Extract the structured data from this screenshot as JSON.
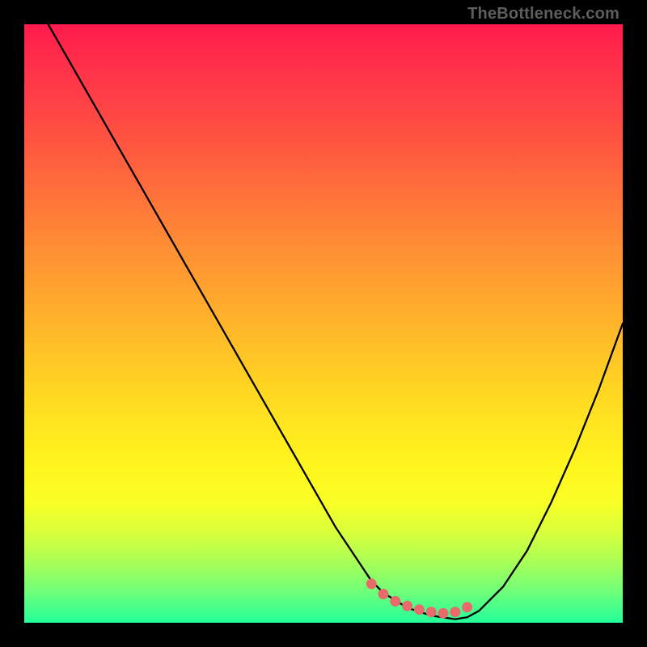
{
  "attribution": "TheBottleneck.com",
  "chart_data": {
    "type": "line",
    "title": "",
    "xlabel": "",
    "ylabel": "",
    "xlim": [
      0,
      100
    ],
    "ylim": [
      0,
      100
    ],
    "x": [
      4,
      8,
      12,
      16,
      20,
      24,
      28,
      32,
      36,
      40,
      44,
      48,
      52,
      56,
      58,
      60,
      64,
      68,
      72,
      74,
      76,
      80,
      84,
      88,
      92,
      96,
      100
    ],
    "values": [
      100,
      93,
      86,
      79,
      72,
      65,
      58,
      51,
      44,
      37,
      30,
      23,
      16,
      10,
      7,
      5,
      2.5,
      1.2,
      0.6,
      0.9,
      2,
      6,
      12,
      20,
      29,
      39,
      50
    ],
    "markers": {
      "x": [
        58,
        60,
        62,
        64,
        66,
        68,
        70,
        72,
        74
      ],
      "values": [
        6.5,
        4.8,
        3.6,
        2.8,
        2.2,
        1.8,
        1.6,
        1.8,
        2.6
      ],
      "color": "#e96a6a"
    },
    "gradient_stops": [
      {
        "pos": 0,
        "color": "#ff1a4d"
      },
      {
        "pos": 50,
        "color": "#ffc824"
      },
      {
        "pos": 80,
        "color": "#f8ff26"
      },
      {
        "pos": 100,
        "color": "#22ff9a"
      }
    ]
  }
}
